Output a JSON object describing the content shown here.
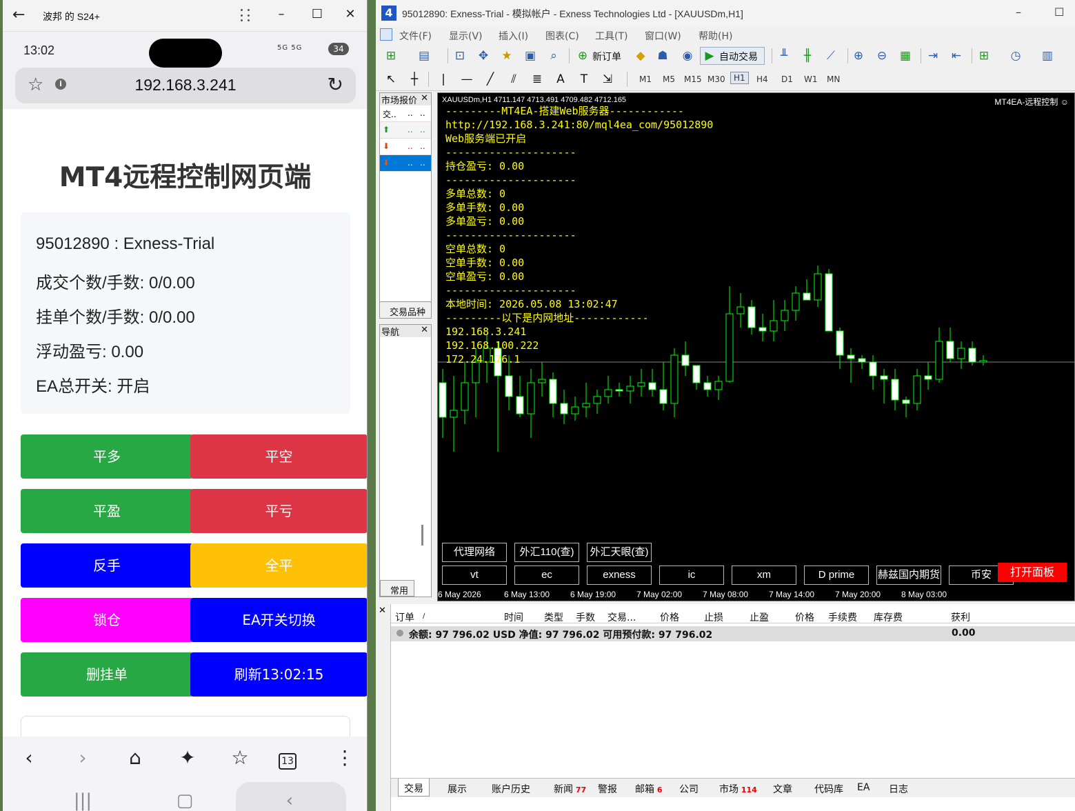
{
  "phone_window": {
    "title": "波邦 的 S24+",
    "status_time": "13:02",
    "battery": "34",
    "signal": "5G 5G",
    "url": "192.168.3.241",
    "page_title": "MT4远程控制网页端",
    "info": {
      "account": "95012890 : Exness-Trial",
      "filled": "成交个数/手数: 0/0.00",
      "pending": "挂单个数/手数: 0/0.00",
      "floating": "浮动盈亏: 0.00",
      "ea_switch": "EA总开关: 开启"
    },
    "buttons": [
      {
        "label": "平多",
        "color": "#28a745"
      },
      {
        "label": "平空",
        "color": "#dc3545"
      },
      {
        "label": "平盈",
        "color": "#28a745"
      },
      {
        "label": "平亏",
        "color": "#dc3545"
      },
      {
        "label": "反手",
        "color": "#0000ff"
      },
      {
        "label": "全平",
        "color": "#ffc107"
      },
      {
        "label": "锁仓",
        "color": "#ff00ff"
      },
      {
        "label": "EA开关切换",
        "color": "#0000ff"
      },
      {
        "label": "删挂单",
        "color": "#28a745"
      },
      {
        "label": "刷新13:02:15",
        "color": "#0000ff"
      }
    ],
    "nav_icons": [
      "back-icon",
      "forward-icon",
      "home-icon",
      "sparkle-icon",
      "bookmark-star-icon",
      "tabs-icon",
      "more-icon"
    ],
    "tabs_count": "13"
  },
  "mt4": {
    "title": "95012890: Exness-Trial - 模拟帐户 - Exness Technologies Ltd - [XAUUSDm,H1]",
    "menu": [
      "文件(F)",
      "显示(V)",
      "插入(I)",
      "图表(C)",
      "工具(T)",
      "窗口(W)",
      "帮助(H)"
    ],
    "toolbar_new_order": "新订单",
    "toolbar_auto_trade": "自动交易",
    "timeframes": [
      "M1",
      "M5",
      "M15",
      "M30",
      "H1",
      "H4",
      "D1",
      "W1",
      "MN"
    ],
    "active_timeframe": "H1",
    "market_watch": {
      "title": "市场报价",
      "col": "交..",
      "tab": "交易品种"
    },
    "navigator": {
      "title": "导航",
      "tab": "常用"
    },
    "chart": {
      "header": "XAUUSDm,H1  4711.147 4713.491 4709.482 4712.165",
      "ea_name": "MT4EA-远程控制 ☺",
      "ea_lines": [
        "---------MT4EA-搭建Web服务器------------",
        "http://192.168.3.241:80/mql4ea_com/95012890",
        "Web服务端已开启",
        "---------------------",
        "持仓盈亏: 0.00",
        "---------------------",
        "多单总数: 0",
        "多单手数: 0.00",
        "多单盈亏: 0.00",
        "---------------------",
        "空单总数: 0",
        "空单手数: 0.00",
        "空单盈亏: 0.00",
        "---------------------",
        "本地时间: 2026.05.08 13:02:47",
        "---------以下是内网地址------------",
        "192.168.3.241",
        "192.168.100.222",
        "172.24.176.1"
      ],
      "buttons_row1": [
        "代理网络",
        "外汇110(查)",
        "外汇天眼(查)"
      ],
      "buttons_row2": [
        "vt",
        "ec",
        "exness",
        "ic",
        "xm",
        "D prime",
        "赫兹国内期货",
        "币安"
      ],
      "open_panel": "打开面板",
      "x_labels": [
        "6 May 2026",
        "6 May 13:00",
        "6 May 19:00",
        "7 May 02:00",
        "7 May 08:00",
        "7 May 14:00",
        "7 May 20:00",
        "8 May 03:00"
      ],
      "colors": {
        "bull": "#00ff00",
        "bear_body": "#ffffff",
        "text": "#ffff00"
      }
    },
    "terminal": {
      "headers": [
        "订单",
        "/",
        "时间",
        "类型",
        "手数",
        "交易...",
        "价格",
        "止损",
        "止盈",
        "价格",
        "手续费",
        "库存费",
        "获利"
      ],
      "balance_row": "余额: 97 796.02 USD  净值: 97 796.02  可用预付款: 97 796.02",
      "profit": "0.00",
      "tabs": [
        {
          "label": "交易",
          "badge": ""
        },
        {
          "label": "展示",
          "badge": ""
        },
        {
          "label": "账户历史",
          "badge": ""
        },
        {
          "label": "新闻",
          "badge": "77"
        },
        {
          "label": "警报",
          "badge": ""
        },
        {
          "label": "邮箱",
          "badge": "6"
        },
        {
          "label": "公司",
          "badge": ""
        },
        {
          "label": "市场",
          "badge": "114"
        },
        {
          "label": "文章",
          "badge": ""
        },
        {
          "label": "代码库",
          "badge": ""
        },
        {
          "label": "EA",
          "badge": ""
        },
        {
          "label": "日志",
          "badge": ""
        }
      ]
    }
  }
}
